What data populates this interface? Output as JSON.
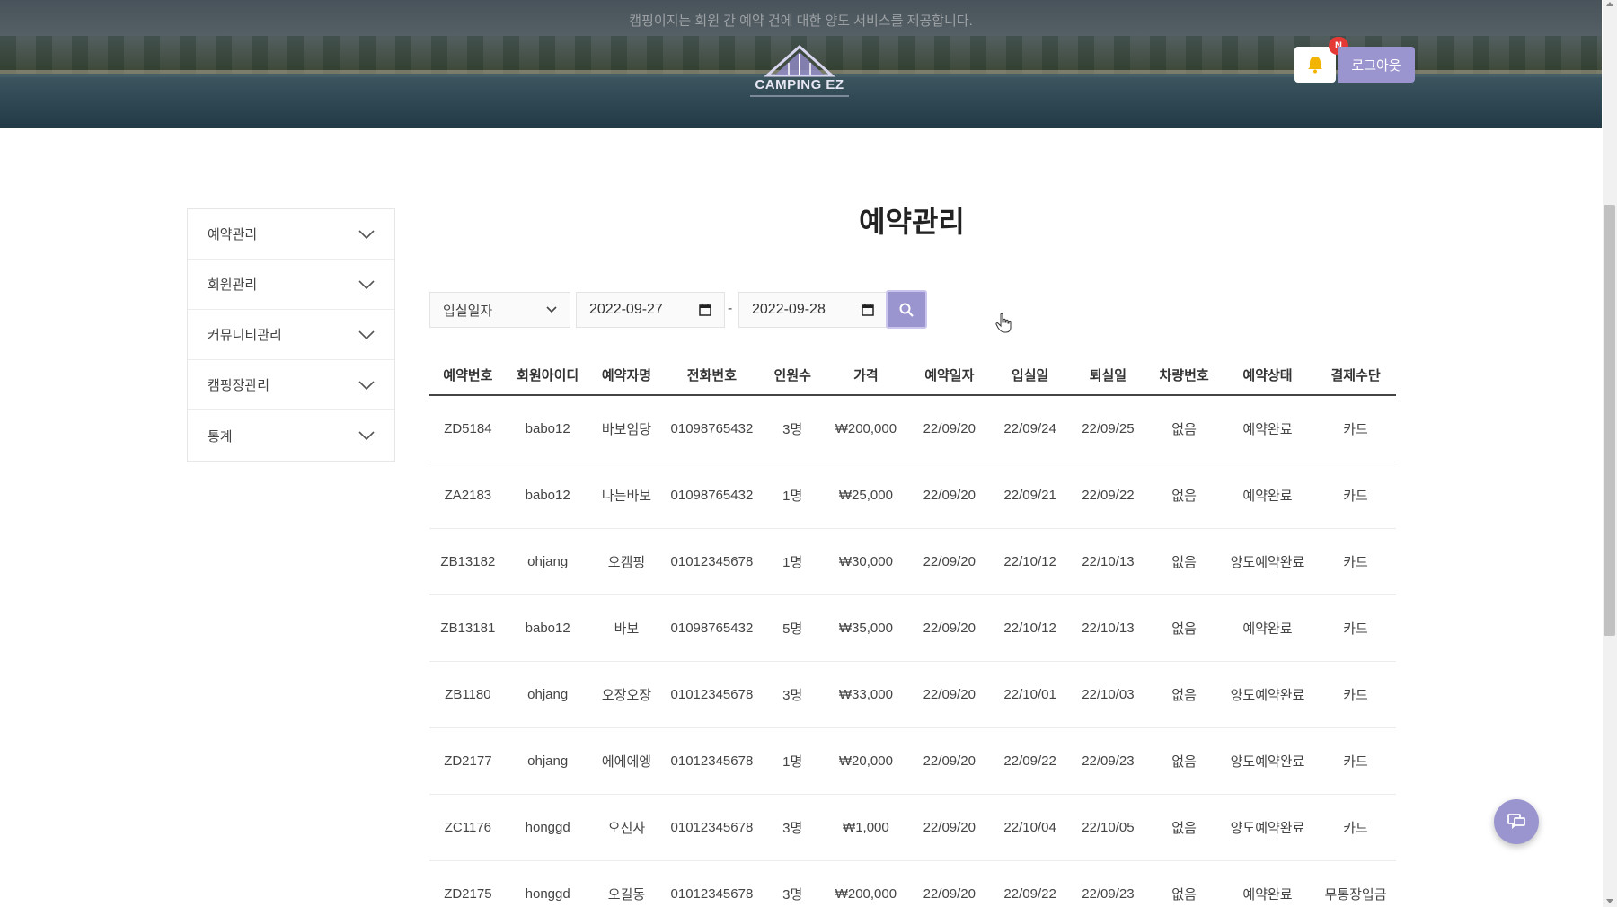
{
  "header": {
    "tagline": "캠핑이지는 회원 간 예약 건에 대한 양도 서비스를 제공합니다.",
    "logo_text": "CAMPING EZ",
    "notification_badge": "N",
    "logout_label": "로그아웃"
  },
  "sidebar": {
    "items": [
      {
        "label": "예약관리",
        "icon": "chevron-down-icon"
      },
      {
        "label": "회원관리",
        "icon": "chevron-down-icon"
      },
      {
        "label": "커뮤니티관리",
        "icon": "chevron-down-icon"
      },
      {
        "label": "캠핑장관리",
        "icon": "chevron-down-icon"
      },
      {
        "label": "통계",
        "icon": "chevron-down-icon"
      }
    ]
  },
  "main": {
    "title": "예약관리",
    "filter": {
      "select_value": "입실일자",
      "date_from": "2022-09-27",
      "date_to": "2022-09-28",
      "separator": "-"
    },
    "table": {
      "headers": [
        "예약번호",
        "회원아이디",
        "예약자명",
        "전화번호",
        "인원수",
        "가격",
        "예약일자",
        "입실일",
        "퇴실일",
        "차량번호",
        "예약상태",
        "결제수단"
      ],
      "rows": [
        [
          "ZD5184",
          "babo12",
          "바보임당",
          "01098765432",
          "3명",
          "₩200,000",
          "22/09/20",
          "22/09/24",
          "22/09/25",
          "없음",
          "예약완료",
          "카드"
        ],
        [
          "ZA2183",
          "babo12",
          "나는바보",
          "01098765432",
          "1명",
          "₩25,000",
          "22/09/20",
          "22/09/21",
          "22/09/22",
          "없음",
          "예약완료",
          "카드"
        ],
        [
          "ZB13182",
          "ohjang",
          "오캠핑",
          "01012345678",
          "1명",
          "₩30,000",
          "22/09/20",
          "22/10/12",
          "22/10/13",
          "없음",
          "양도예약완료",
          "카드"
        ],
        [
          "ZB13181",
          "babo12",
          "바보",
          "01098765432",
          "5명",
          "₩35,000",
          "22/09/20",
          "22/10/12",
          "22/10/13",
          "없음",
          "예약완료",
          "카드"
        ],
        [
          "ZB1180",
          "ohjang",
          "오장오장",
          "01012345678",
          "3명",
          "₩33,000",
          "22/09/20",
          "22/10/01",
          "22/10/03",
          "없음",
          "양도예약완료",
          "카드"
        ],
        [
          "ZD2177",
          "ohjang",
          "에에에엥",
          "01012345678",
          "1명",
          "₩20,000",
          "22/09/20",
          "22/09/22",
          "22/09/23",
          "없음",
          "양도예약완료",
          "카드"
        ],
        [
          "ZC1176",
          "honggd",
          "오신사",
          "01012345678",
          "3명",
          "₩1,000",
          "22/09/20",
          "22/10/04",
          "22/10/05",
          "없음",
          "양도예약완료",
          "카드"
        ],
        [
          "ZD2175",
          "honggd",
          "오길동",
          "01012345678",
          "3명",
          "₩200,000",
          "22/09/20",
          "22/09/22",
          "22/09/23",
          "없음",
          "예약완료",
          "무통장입금"
        ]
      ]
    }
  },
  "colors": {
    "accent": "#9b95cf",
    "badge": "#e53935"
  }
}
